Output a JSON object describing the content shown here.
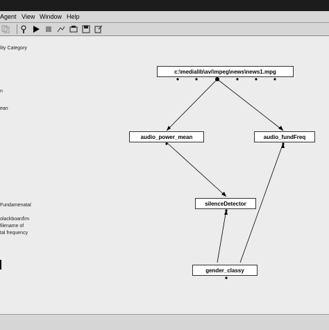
{
  "menu": {
    "agent": "Agent",
    "view": "View",
    "window": "Window",
    "help": "Help"
  },
  "toolbar": {
    "icons": [
      "copy-icon",
      "refresh-icon",
      "settings-icon",
      "run-icon",
      "stop-icon",
      "graph-icon",
      "tools-icon",
      "save-icon",
      "export-icon"
    ]
  },
  "left_panel": {
    "lines": [
      "lity Category",
      "n",
      "ean",
      "Fundamenatal",
      "olackboard\\m",
      "filename of",
      "tal frequency"
    ]
  },
  "graph": {
    "nodes": {
      "source": "c:\\medialib\\avi\\mpeg\\news\\news1.mpg",
      "power_mean": "audio_power_mean",
      "fund_freq": "audio_fundFreq",
      "silence": "silenceDetector",
      "gender": "gender_classy"
    }
  }
}
